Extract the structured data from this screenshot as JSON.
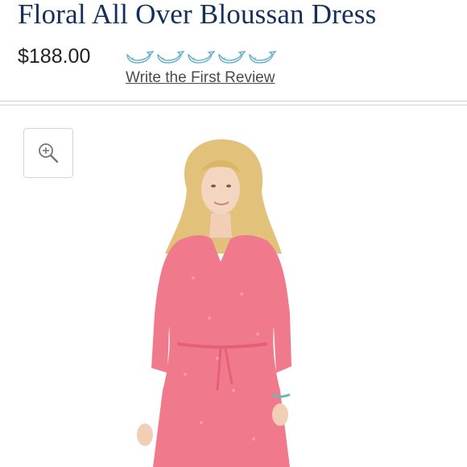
{
  "product": {
    "title": "Floral All Over Bloussan Dress",
    "price": "$188.00",
    "rating": {
      "value": 0,
      "max": 5,
      "icon": "whale-icon",
      "outline_color": "#5aa9c9"
    },
    "review_link": "Write the First Review"
  },
  "gallery": {
    "zoom_icon": "zoom-in-icon",
    "image_alt": "Model wearing pink floral dress"
  },
  "colors": {
    "title": "#14305a",
    "dress": "#f07a8c",
    "hair": "#e2c27a"
  }
}
